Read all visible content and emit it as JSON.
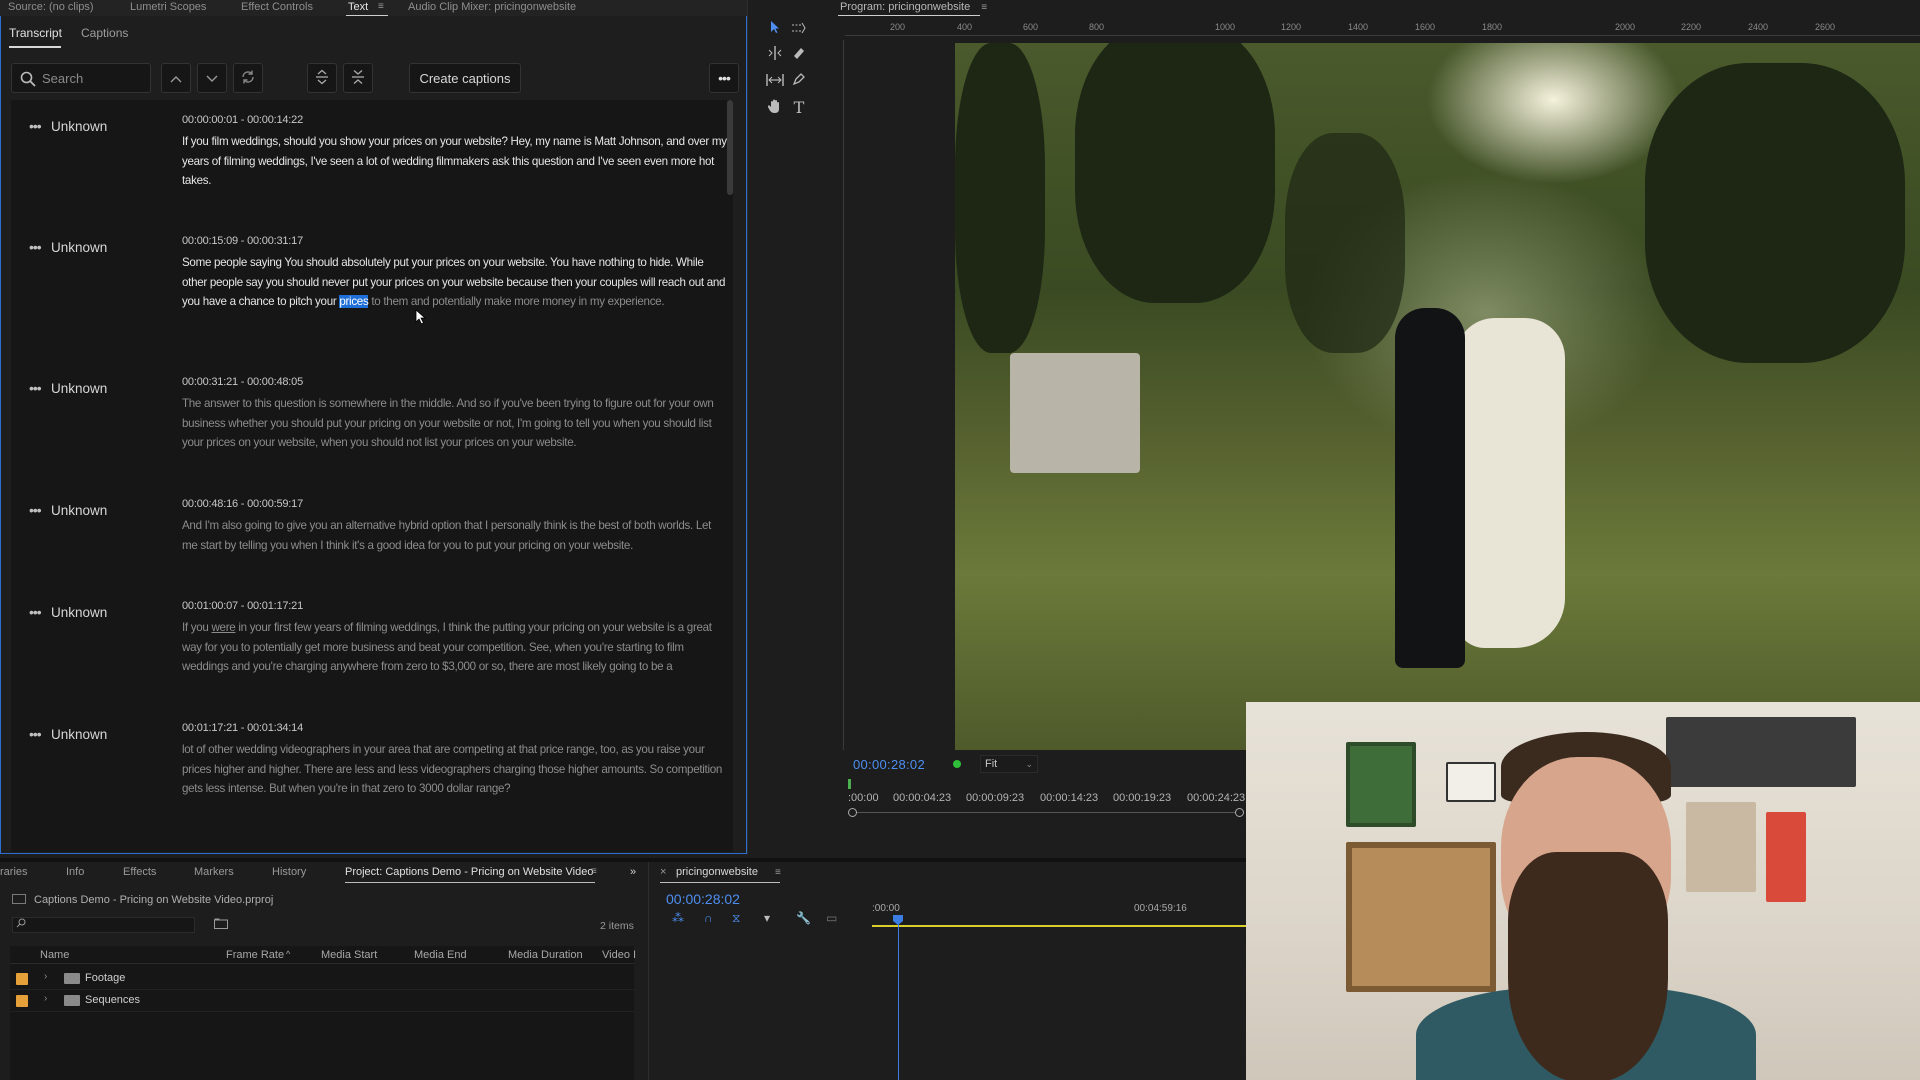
{
  "source_panel": {
    "tabs": [
      {
        "label": "Source: (no clips)"
      },
      {
        "label": "Lumetri Scopes"
      },
      {
        "label": "Effect Controls"
      },
      {
        "label": "Text"
      },
      {
        "label": "Audio Clip Mixer: pricingonwebsite"
      }
    ],
    "menu_glyph": "≡"
  },
  "text_panel": {
    "subtabs": [
      "Transcript",
      "Captions"
    ],
    "search_placeholder": "Search",
    "create_captions_label": "Create captions",
    "more_label": "•••",
    "segments": [
      {
        "speaker": "Unknown",
        "timecode": "00:00:00:01 - 00:00:14:22",
        "text": "If you film weddings, should you show your prices on your website? Hey, my name is Matt Johnson, and over my years of filming weddings, I've seen a lot of wedding filmmakers ask this question and I've seen even more hot takes."
      },
      {
        "speaker": "Unknown",
        "timecode": "00:00:15:09 - 00:00:31:17",
        "text_before": "Some people saying You should absolutely put your prices on your website. You have nothing to hide. While other people say you should never put your prices on your website because then your couples will reach out and you have a chance to pitch your ",
        "highlight": "prices",
        "text_after": " to them and potentially make more money in my experience."
      },
      {
        "speaker": "Unknown",
        "timecode": "00:00:31:21 - 00:00:48:05",
        "text": "The answer to this question is somewhere in the middle. And so if you've been trying to figure out for your own business whether you should put your pricing on your website or not, I'm going to tell you when you should list your prices on your website, when you should not list your prices on your website."
      },
      {
        "speaker": "Unknown",
        "timecode": "00:00:48:16 - 00:00:59:17",
        "text": "And I'm also going to give you an alternative hybrid option that I personally think is the best of both worlds. Let me start by telling you when I think it's a good idea for you to put your pricing on your website."
      },
      {
        "speaker": "Unknown",
        "timecode": "00:01:00:07 - 00:01:17:21",
        "text_before": "If you ",
        "underline": "were",
        "text_after": " in your first few years of filming weddings, I think the putting your pricing on your website is a great way for you to potentially get more business and beat your competition. See, when you're starting to film weddings and you're charging anywhere from zero to $3,000 or so, there are most likely going to be a"
      },
      {
        "speaker": "Unknown",
        "timecode": "00:01:17:21 - 00:01:34:14",
        "text": "lot of other wedding videographers in your area that are competing at that price range, too, as you raise your prices higher and higher. There are less and less videographers charging those higher amounts. So competition gets less intense. But when you're in that zero to 3000 dollar range?"
      }
    ]
  },
  "program_monitor": {
    "title": "Program: pricingonwebsite",
    "ruler_ticks": [
      "200",
      "400",
      "600",
      "800",
      "1000",
      "1200",
      "1400",
      "1600",
      "1800",
      "2000",
      "2200",
      "2400",
      "2600"
    ],
    "timecode": "00:00:28:02",
    "fit_label": "Fit",
    "mini_ruler": [
      ":00:00",
      "00:00:04:23",
      "00:00:09:23",
      "00:00:14:23",
      "00:00:19:23",
      "00:00:24:23"
    ]
  },
  "project_panel": {
    "tabs": [
      {
        "label": "raries"
      },
      {
        "label": "Info"
      },
      {
        "label": "Effects"
      },
      {
        "label": "Markers"
      },
      {
        "label": "History"
      },
      {
        "label": "Project: Captions Demo - Pricing on Website Video"
      }
    ],
    "overflow_label": "»",
    "file_name": "Captions Demo - Pricing on Website Video.prproj",
    "items_count": "2 items",
    "columns": [
      "Name",
      "Frame Rate",
      "Media Start",
      "Media End",
      "Media Duration",
      "Video I"
    ],
    "rows": [
      {
        "name": "Footage",
        "color": "#e6a03a"
      },
      {
        "name": "Sequences",
        "color": "#e6a03a"
      }
    ]
  },
  "timeline": {
    "close_label": "×",
    "sequence_name": "pricingonwebsite",
    "timecode": "00:00:28:02",
    "ruler_labels": [
      ":00:00",
      "00:04:59:16"
    ]
  },
  "colors": {
    "accent_blue": "#4d8ef0",
    "highlight_blue": "#1f6fd8",
    "label_orange": "#e6a03a",
    "work_area_yellow": "#d9d02b",
    "status_green": "#2fbf3a"
  }
}
